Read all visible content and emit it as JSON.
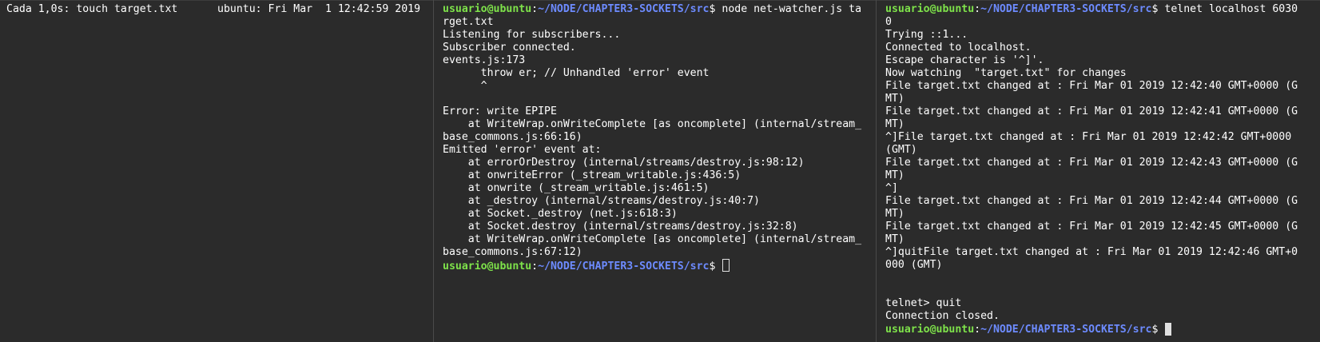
{
  "panes": {
    "watch": {
      "command": "Cada 1,0s: touch target.txt",
      "host_time": "ubuntu: Fri Mar  1 12:42:59 2019"
    },
    "node": {
      "prompt_user": "usuario@ubuntu",
      "prompt_sep": ":",
      "prompt_path": "~/NODE/CHAPTER3-SOCKETS/src",
      "prompt_symbol": "$ ",
      "command_line1": "node net-watcher.js ta",
      "lines": [
        "rget.txt",
        "Listening for subscribers...",
        "Subscriber connected.",
        "events.js:173",
        "      throw er; // Unhandled 'error' event",
        "      ^",
        "",
        "Error: write EPIPE",
        "    at WriteWrap.onWriteComplete [as oncomplete] (internal/stream_",
        "base_commons.js:66:16)",
        "Emitted 'error' event at:",
        "    at errorOrDestroy (internal/streams/destroy.js:98:12)",
        "    at onwriteError (_stream_writable.js:436:5)",
        "    at onwrite (_stream_writable.js:461:5)",
        "    at _destroy (internal/streams/destroy.js:40:7)",
        "    at Socket._destroy (net.js:618:3)",
        "    at Socket.destroy (internal/streams/destroy.js:32:8)",
        "    at WriteWrap.onWriteComplete [as oncomplete] (internal/stream_",
        "base_commons.js:67:12)"
      ],
      "final_prompt_symbol": "$ "
    },
    "telnet": {
      "prompt_user": "usuario@ubuntu",
      "prompt_sep": ":",
      "prompt_path": "~/NODE/CHAPTER3-SOCKETS/src",
      "prompt_symbol": "$ ",
      "command_line1": "telnet localhost 6030",
      "lines": [
        "0",
        "Trying ::1...",
        "Connected to localhost.",
        "Escape character is '^]'.",
        "Now watching  \"target.txt\" for changes",
        "File target.txt changed at : Fri Mar 01 2019 12:42:40 GMT+0000 (G",
        "MT)",
        "File target.txt changed at : Fri Mar 01 2019 12:42:41 GMT+0000 (G",
        "MT)",
        "^]File target.txt changed at : Fri Mar 01 2019 12:42:42 GMT+0000",
        "(GMT)",
        "File target.txt changed at : Fri Mar 01 2019 12:42:43 GMT+0000 (G",
        "MT)",
        "^]",
        "File target.txt changed at : Fri Mar 01 2019 12:42:44 GMT+0000 (G",
        "MT)",
        "File target.txt changed at : Fri Mar 01 2019 12:42:45 GMT+0000 (G",
        "MT)",
        "^]quitFile target.txt changed at : Fri Mar 01 2019 12:42:46 GMT+0",
        "000 (GMT)",
        "",
        "",
        "telnet> quit",
        "Connection closed."
      ],
      "final_prompt_symbol": "$ "
    }
  },
  "colors": {
    "background": "#2b2b2b",
    "prompt_user": "#7ee24a",
    "prompt_path": "#6d8bff",
    "text": "#ffffff"
  }
}
